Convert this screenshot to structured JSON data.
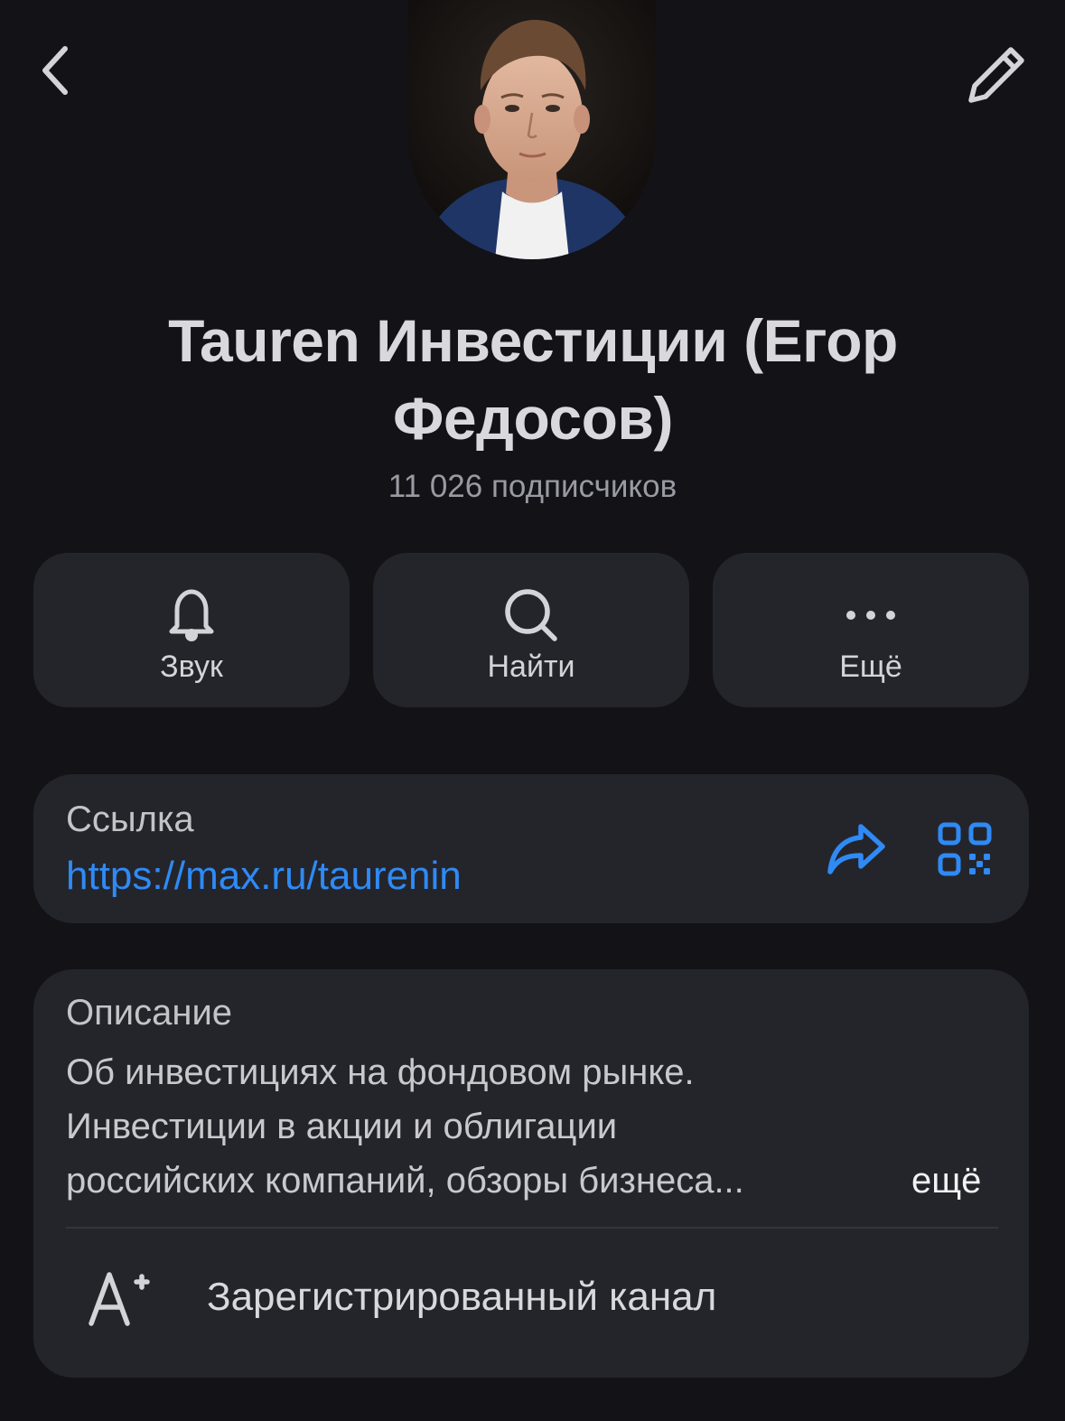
{
  "header": {
    "back_icon": "chevron-left-icon",
    "edit_icon": "pencil-icon"
  },
  "profile": {
    "name": "Tauren Инвестиции (Егор Федосов)",
    "subscribers": "11 026 подписчиков"
  },
  "actions": [
    {
      "label": "Звук",
      "icon": "bell-icon"
    },
    {
      "label": "Найти",
      "icon": "search-icon"
    },
    {
      "label": "Ещё",
      "icon": "more-dots-icon"
    }
  ],
  "link": {
    "caption": "Ссылка",
    "url": "https://max.ru/taurenin",
    "share_icon": "share-icon",
    "qr_icon": "qr-code-icon",
    "accent_color": "#2f8af5"
  },
  "description": {
    "caption": "Описание",
    "lines": [
      "Об инвестициях на фондовом рынке.",
      "Инвестиции в акции и облигации",
      "российских компаний, обзоры бизнеса..."
    ],
    "more_label": "ещё"
  },
  "registered": {
    "label": "Зарегистрированный канал",
    "icon": "registered-a-plus-icon"
  }
}
